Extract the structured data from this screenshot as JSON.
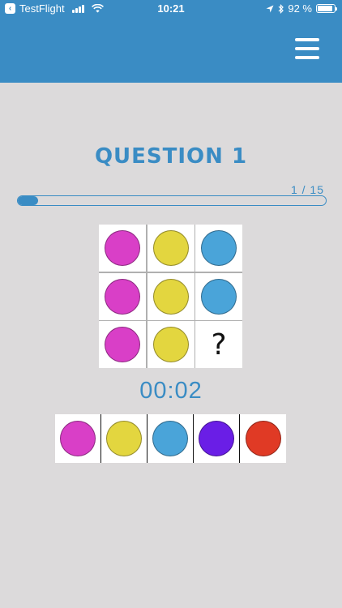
{
  "status_bar": {
    "carrier": "TestFlight",
    "time": "10:21",
    "battery": "92 %",
    "battery_level": 0.92
  },
  "question": {
    "title": "QUESTION 1",
    "progress_label": "1 / 15",
    "progress_fraction": 0.0667
  },
  "grid": [
    [
      {
        "color": "#d93fc7"
      },
      {
        "color": "#e3d63f"
      },
      {
        "color": "#4aa4d9"
      }
    ],
    [
      {
        "color": "#d93fc7"
      },
      {
        "color": "#e3d63f"
      },
      {
        "color": "#4aa4d9"
      }
    ],
    [
      {
        "color": "#d93fc7"
      },
      {
        "color": "#e3d63f"
      },
      {
        "symbol": "?"
      }
    ]
  ],
  "timer": "00:02",
  "options": [
    {
      "color": "#d93fc7"
    },
    {
      "color": "#e3d63f"
    },
    {
      "color": "#4aa4d9"
    },
    {
      "color": "#6a1ee6"
    },
    {
      "color": "#e03a25"
    }
  ],
  "accent_color": "#3a8cc4"
}
